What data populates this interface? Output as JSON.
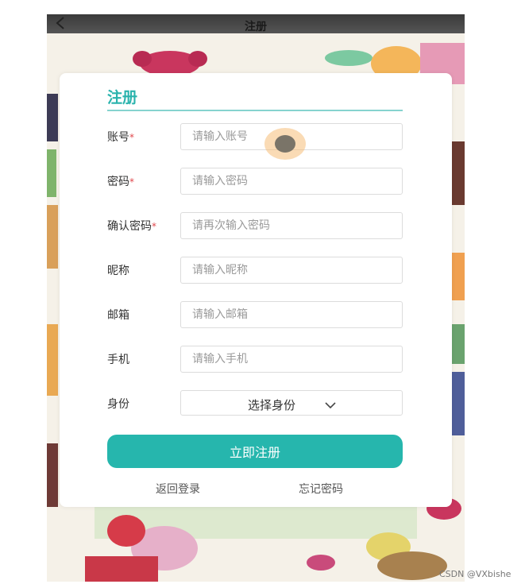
{
  "header": {
    "back_icon": "chevron-left-icon",
    "title": "注册"
  },
  "form": {
    "title": "注册",
    "fields": [
      {
        "label": "账号",
        "required": "*",
        "placeholder": "请输入账号"
      },
      {
        "label": "密码",
        "required": "*",
        "placeholder": "请输入密码"
      },
      {
        "label": "确认密码",
        "required": "*",
        "placeholder": "请再次输入密码"
      },
      {
        "label": "昵称",
        "required": "",
        "placeholder": "请输入昵称"
      },
      {
        "label": "邮箱",
        "required": "",
        "placeholder": "请输入邮箱"
      },
      {
        "label": "手机",
        "required": "",
        "placeholder": "请输入手机"
      }
    ],
    "role": {
      "label": "身份",
      "value": "选择身份",
      "icon": "chevron-down-icon"
    },
    "submit_label": "立即注册",
    "back_login": "返回登录",
    "forgot_password": "忘记密码"
  },
  "watermark": "CSDN @VXbishe",
  "colors": {
    "accent": "#26b6ad",
    "title": "#2ab3ad",
    "required": "#e0474c"
  }
}
